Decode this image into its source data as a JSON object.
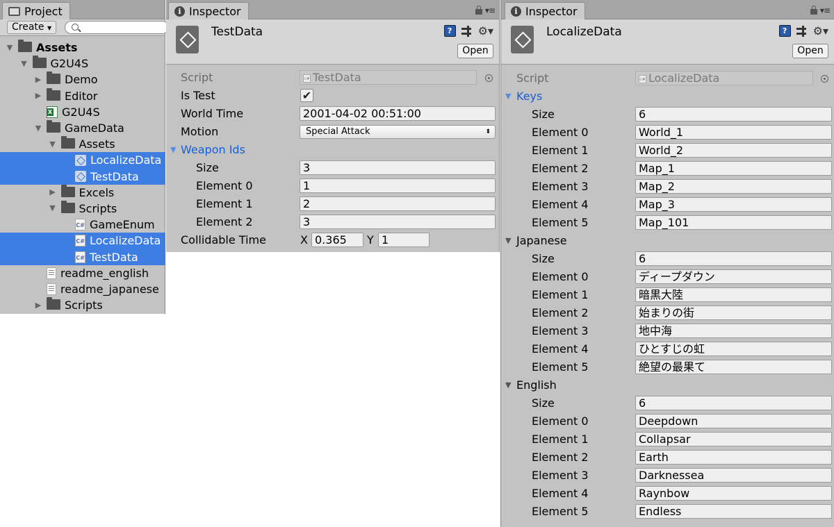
{
  "project": {
    "tab_label": "Project",
    "create_label": "Create",
    "tree": [
      {
        "label": "Assets",
        "depth": 0,
        "icon": "folder",
        "arrow": "down",
        "bold": true,
        "selected": false
      },
      {
        "label": "G2U4S",
        "depth": 1,
        "icon": "folder",
        "arrow": "down",
        "bold": false,
        "selected": false
      },
      {
        "label": "Demo",
        "depth": 2,
        "icon": "folder",
        "arrow": "right",
        "bold": false,
        "selected": false
      },
      {
        "label": "Editor",
        "depth": 2,
        "icon": "folder",
        "arrow": "right",
        "bold": false,
        "selected": false
      },
      {
        "label": "G2U4S",
        "depth": 2,
        "icon": "xls",
        "arrow": "",
        "bold": false,
        "selected": false
      },
      {
        "label": "GameData",
        "depth": 2,
        "icon": "folder",
        "arrow": "down",
        "bold": false,
        "selected": false
      },
      {
        "label": "Assets",
        "depth": 3,
        "icon": "folder",
        "arrow": "down",
        "bold": false,
        "selected": false
      },
      {
        "label": "LocalizeData",
        "depth": 4,
        "icon": "so",
        "arrow": "",
        "bold": false,
        "selected": true
      },
      {
        "label": "TestData",
        "depth": 4,
        "icon": "so",
        "arrow": "",
        "bold": false,
        "selected": true
      },
      {
        "label": "Excels",
        "depth": 3,
        "icon": "folder",
        "arrow": "right",
        "bold": false,
        "selected": false
      },
      {
        "label": "Scripts",
        "depth": 3,
        "icon": "folder",
        "arrow": "down",
        "bold": false,
        "selected": false
      },
      {
        "label": "GameEnum",
        "depth": 4,
        "icon": "cs",
        "arrow": "",
        "bold": false,
        "selected": false
      },
      {
        "label": "LocalizeData",
        "depth": 4,
        "icon": "cs",
        "arrow": "",
        "bold": false,
        "selected": true
      },
      {
        "label": "TestData",
        "depth": 4,
        "icon": "cs",
        "arrow": "",
        "bold": false,
        "selected": true
      },
      {
        "label": "readme_english",
        "depth": 2,
        "icon": "txt",
        "arrow": "",
        "bold": false,
        "selected": false
      },
      {
        "label": "readme_japanese",
        "depth": 2,
        "icon": "txt",
        "arrow": "",
        "bold": false,
        "selected": false
      },
      {
        "label": "Scripts",
        "depth": 2,
        "icon": "folder",
        "arrow": "right",
        "bold": false,
        "selected": false
      }
    ]
  },
  "inspector1": {
    "tab_label": "Inspector",
    "title": "TestData",
    "open_label": "Open",
    "script_label": "Script",
    "script_value": "TestData",
    "is_test_label": "Is Test",
    "is_test_checked": true,
    "world_time_label": "World Time",
    "world_time_value": "2001-04-02 00:51:00",
    "motion_label": "Motion",
    "motion_value": "Special Attack",
    "weapon_ids_label": "Weapon Ids",
    "size_label": "Size",
    "size_value": "3",
    "elements": [
      {
        "label": "Element 0",
        "value": "1"
      },
      {
        "label": "Element 1",
        "value": "2"
      },
      {
        "label": "Element 2",
        "value": "3"
      }
    ],
    "collidable_label": "Collidable Time",
    "x_label": "X",
    "x_value": "0.365",
    "y_label": "Y",
    "y_value": "1"
  },
  "inspector2": {
    "tab_label": "Inspector",
    "title": "LocalizeData",
    "open_label": "Open",
    "script_label": "Script",
    "script_value": "LocalizeData",
    "groups": [
      {
        "label": "Keys",
        "highlight": true,
        "size_label": "Size",
        "size_value": "6",
        "elements": [
          {
            "label": "Element 0",
            "value": "World_1"
          },
          {
            "label": "Element 1",
            "value": "World_2"
          },
          {
            "label": "Element 2",
            "value": "Map_1"
          },
          {
            "label": "Element 3",
            "value": "Map_2"
          },
          {
            "label": "Element 4",
            "value": "Map_3"
          },
          {
            "label": "Element 5",
            "value": "Map_101"
          }
        ]
      },
      {
        "label": "Japanese",
        "highlight": false,
        "size_label": "Size",
        "size_value": "6",
        "elements": [
          {
            "label": "Element 0",
            "value": "ディープダウン"
          },
          {
            "label": "Element 1",
            "value": "暗黒大陸"
          },
          {
            "label": "Element 2",
            "value": "始まりの街"
          },
          {
            "label": "Element 3",
            "value": "地中海"
          },
          {
            "label": "Element 4",
            "value": "ひとすじの虹"
          },
          {
            "label": "Element 5",
            "value": "絶望の最果て"
          }
        ]
      },
      {
        "label": "English",
        "highlight": false,
        "size_label": "Size",
        "size_value": "6",
        "elements": [
          {
            "label": "Element 0",
            "value": "Deepdown"
          },
          {
            "label": "Element 1",
            "value": "Collapsar"
          },
          {
            "label": "Element 2",
            "value": "Earth"
          },
          {
            "label": "Element 3",
            "value": "Darknessea"
          },
          {
            "label": "Element 4",
            "value": "Raynbow"
          },
          {
            "label": "Element 5",
            "value": "Endless"
          }
        ]
      }
    ]
  },
  "colors": {
    "selection": "#3e7de1",
    "panel_bg": "#c3c3c3",
    "foldout_highlight": "#1a5fd1"
  }
}
